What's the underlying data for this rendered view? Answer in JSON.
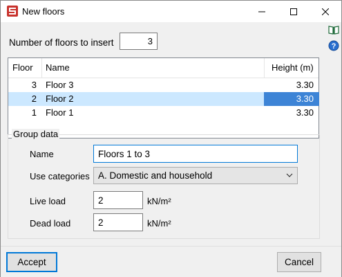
{
  "window": {
    "title": "New floors"
  },
  "floors": {
    "label": "Number of floors to insert",
    "value": "3"
  },
  "table": {
    "headers": {
      "floor": "Floor",
      "name": "Name",
      "height": "Height (m)"
    },
    "rows": [
      {
        "floor": "3",
        "name": "Floor 3",
        "height": "3.30"
      },
      {
        "floor": "2",
        "name": "Floor 2",
        "height": "3.30"
      },
      {
        "floor": "1",
        "name": "Floor 1",
        "height": "3.30"
      }
    ],
    "selected_row": 1
  },
  "group": {
    "legend": "Group data",
    "name_label": "Name",
    "name_value": "Floors 1 to 3",
    "use_label": "Use categories",
    "use_value": "A. Domestic and household",
    "live_label": "Live load",
    "live_value": "2",
    "live_unit": "kN/m²",
    "dead_label": "Dead load",
    "dead_value": "2",
    "dead_unit": "kN/m²"
  },
  "buttons": {
    "accept_label": "Accept",
    "cancel_label": "Cancel"
  },
  "icons": {
    "app": "app-logo-icon",
    "help_book": "help-book-icon",
    "help": "help-question-icon"
  },
  "colors": {
    "selection": "#cce8ff",
    "selection_cell": "#3d84d6",
    "focus": "#0078d7",
    "app_icon": "#c8322c"
  }
}
